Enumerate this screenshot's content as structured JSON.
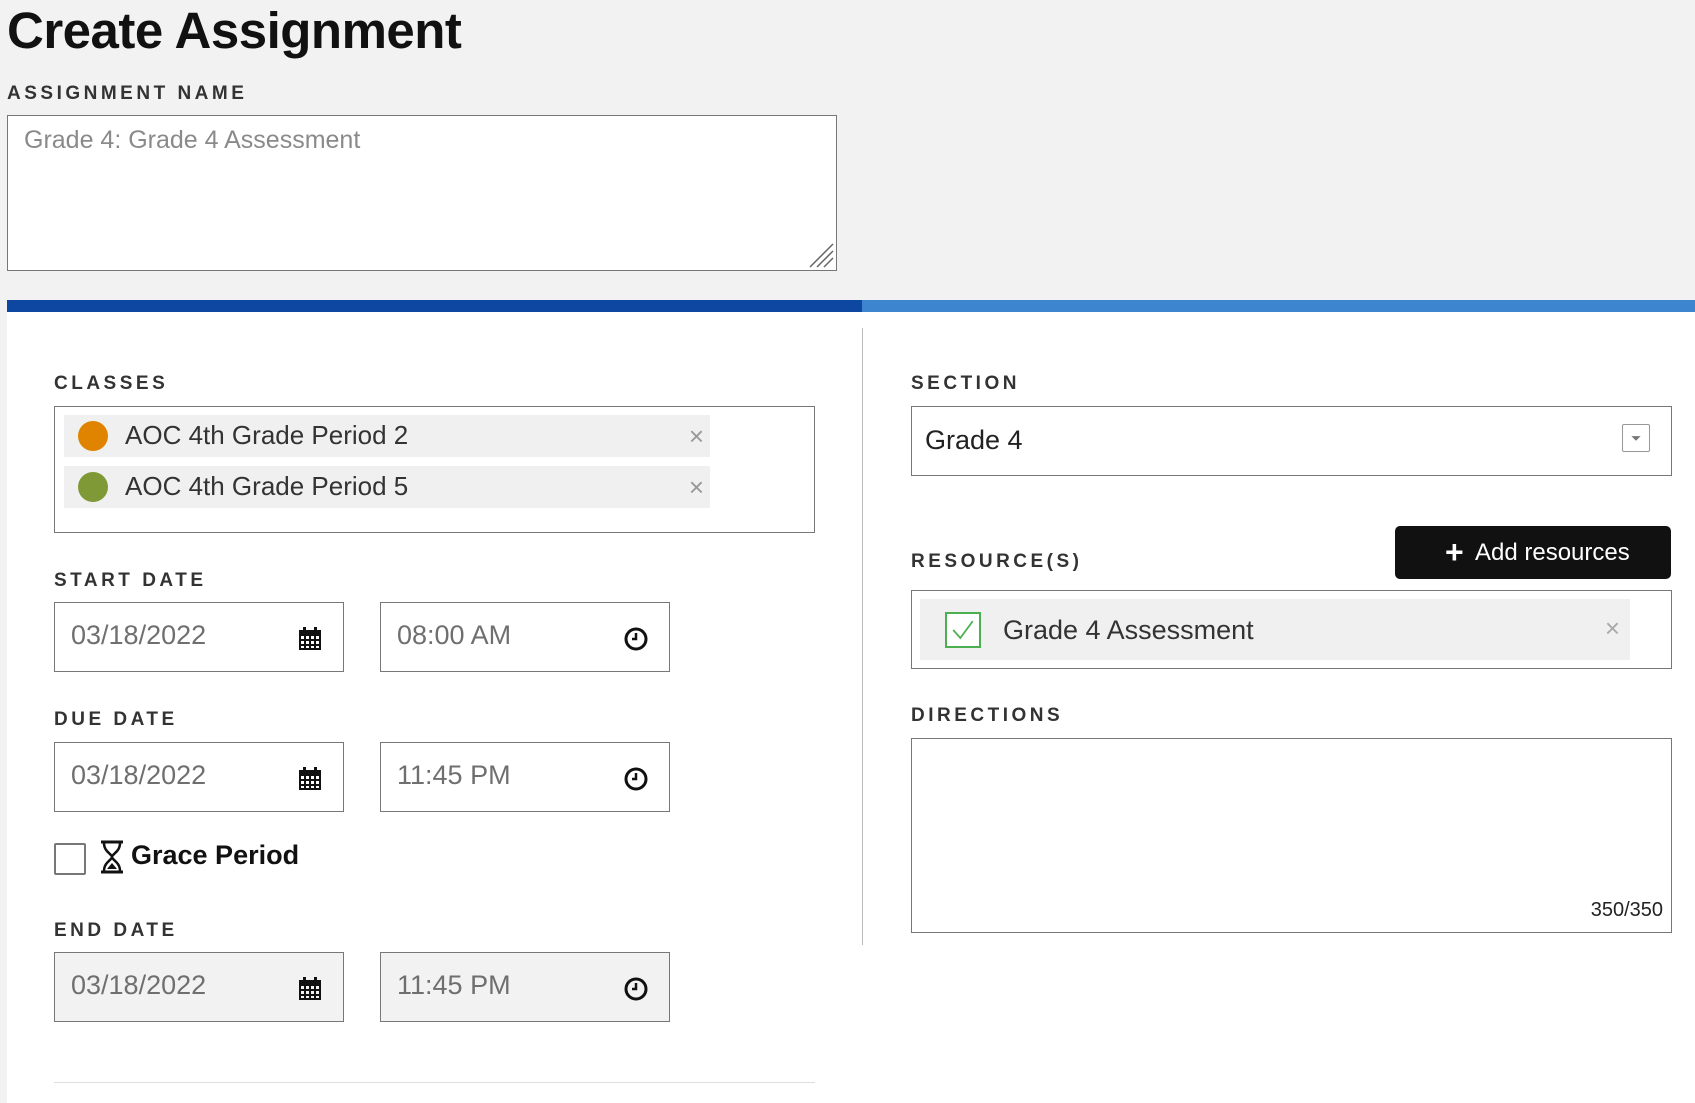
{
  "page": {
    "title": "Create Assignment"
  },
  "assignment_name": {
    "label": "ASSIGNMENT NAME",
    "placeholder": "Grade 4: Grade 4 Assessment"
  },
  "classes": {
    "label": "CLASSES",
    "items": [
      {
        "name": "AOC 4th Grade Period 2",
        "color": "#e08400"
      },
      {
        "name": "AOC 4th Grade Period 5",
        "color": "#7f9937"
      }
    ],
    "remove_icon": "×"
  },
  "start_date": {
    "label": "START DATE",
    "date": "03/18/2022",
    "time": "08:00 AM"
  },
  "due_date": {
    "label": "DUE DATE",
    "date": "03/18/2022",
    "time": "11:45 PM"
  },
  "grace_period": {
    "label": "Grace Period",
    "checked": false
  },
  "end_date": {
    "label": "END DATE",
    "date": "03/18/2022",
    "time": "11:45 PM"
  },
  "section": {
    "label": "SECTION",
    "value": "Grade 4"
  },
  "resources": {
    "label": "RESOURCE(S)",
    "add_button_label": "Add resources",
    "items": [
      {
        "name": "Grade 4 Assessment",
        "checked": true
      }
    ],
    "remove_icon": "×"
  },
  "directions": {
    "label": "DIRECTIONS",
    "counter": "350/350"
  },
  "colors": {
    "progress_dark": "#0d47a1",
    "progress_light": "#3d86cf",
    "check_green": "#4caf50"
  }
}
